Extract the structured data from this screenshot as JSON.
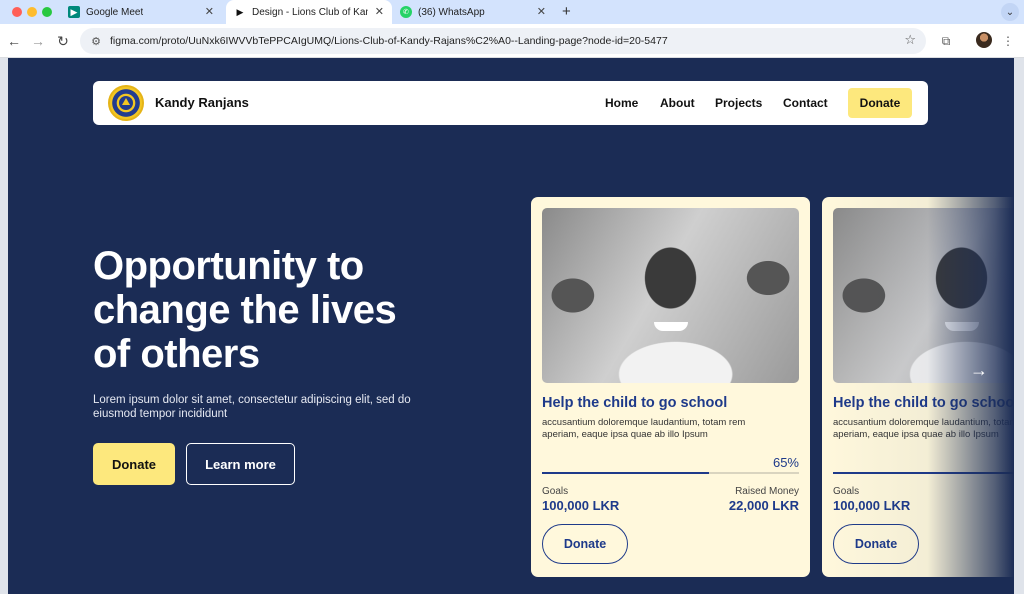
{
  "browser": {
    "tabs": [
      {
        "title": "Google Meet",
        "icon": "google-meet-icon"
      },
      {
        "title": "Design - Lions Club of Kandy",
        "icon": "figma-play-icon"
      },
      {
        "title": "(36) WhatsApp",
        "icon": "whatsapp-icon"
      }
    ],
    "url": "figma.com/proto/UuNxk6IWVVbTePPCAIgUMQ/Lions-Club-of-Kandy-Rajans%C2%A0--Landing-page?node-id=20-5477"
  },
  "nav": {
    "brand": "Kandy Ranjans",
    "links": [
      "Home",
      "About",
      "Projects",
      "Contact"
    ],
    "donate_label": "Donate"
  },
  "hero": {
    "title": "Opportunity to change the lives of others",
    "subtitle": "Lorem ipsum dolor sit amet, consectetur adipiscing elit, sed do eiusmod tempor incididunt",
    "donate_label": "Donate",
    "learn_label": "Learn more"
  },
  "cards": [
    {
      "title": "Help the child to go school",
      "description": "accusantium doloremque laudantium, totam rem aperiam, eaque ipsa quae ab illo Ipsum",
      "progress_percent": 65,
      "progress_label": "65%",
      "goal_label": "Goals",
      "goal_amount": "100,000 LKR",
      "raised_label": "Raised Money",
      "raised_amount": "22,000 LKR",
      "donate_label": "Donate"
    },
    {
      "title": "Help the child to go school",
      "description": "accusantium doloremque laudantium, totam rem aperiam, eaque ipsa quae ab illo Ipsum",
      "goal_label": "Goals",
      "goal_amount": "100,000 LKR",
      "donate_label": "Donate"
    }
  ],
  "colors": {
    "background": "#1b2c55",
    "accent_yellow": "#fde87d",
    "card": "#fff8dc",
    "primary_blue": "#1e3a8a"
  }
}
